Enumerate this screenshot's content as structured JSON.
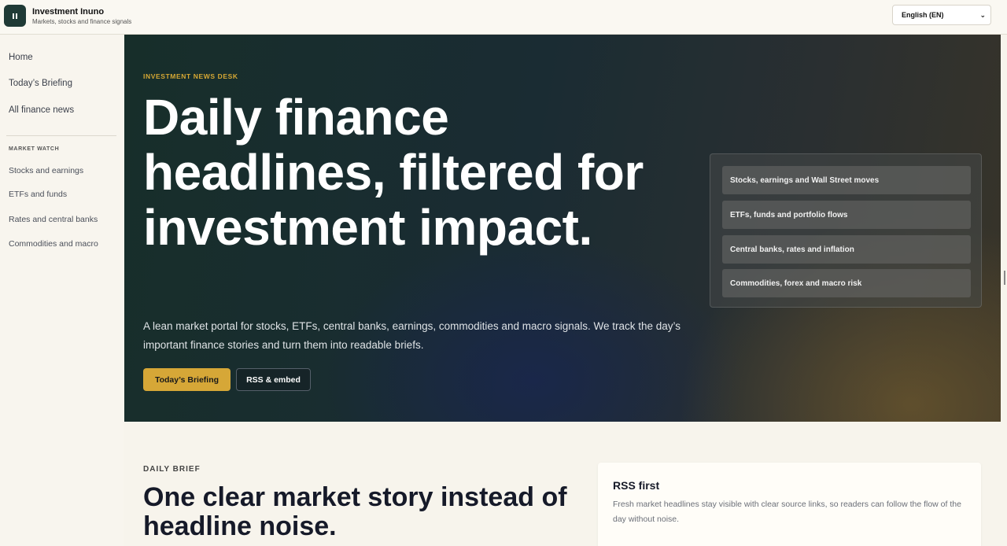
{
  "header": {
    "brand_title": "Investment Inuno",
    "brand_subtitle": "Markets, stocks and finance signals",
    "language": "English (EN)"
  },
  "sidebar": {
    "items": [
      {
        "label": "Home"
      },
      {
        "label": "Today’s Briefing"
      },
      {
        "label": "All finance news"
      }
    ],
    "section_title": "MARKET WATCH",
    "section_items": [
      {
        "label": "Stocks and earnings"
      },
      {
        "label": "ETFs and funds"
      },
      {
        "label": "Rates and central banks"
      },
      {
        "label": "Commodities and macro"
      }
    ]
  },
  "hero": {
    "kicker": "INVESTMENT NEWS DESK",
    "title": "Daily finance headlines, filtered for investment impact.",
    "description": "A lean market portal for stocks, ETFs, central banks, earnings, commodities and macro signals. We track the day’s important finance stories and turn them into readable briefs.",
    "primary_button": "Today’s Briefing",
    "secondary_button": "RSS & embed",
    "topics": [
      {
        "label": "Stocks, earnings and Wall Street moves"
      },
      {
        "label": "ETFs, funds and portfolio flows"
      },
      {
        "label": "Central banks, rates and inflation"
      },
      {
        "label": "Commodities, forex and macro risk"
      }
    ]
  },
  "daily": {
    "kicker": "DAILY BRIEF",
    "title": "One clear market story instead of headline noise.",
    "rss_title": "RSS first",
    "rss_text": "Fresh market headlines stay visible with clear source links, so readers can follow the flow of the day without noise."
  },
  "colors": {
    "accent": "#d6a737",
    "hero_bg": "#172e2a",
    "logo_bg": "#1f3a36"
  }
}
